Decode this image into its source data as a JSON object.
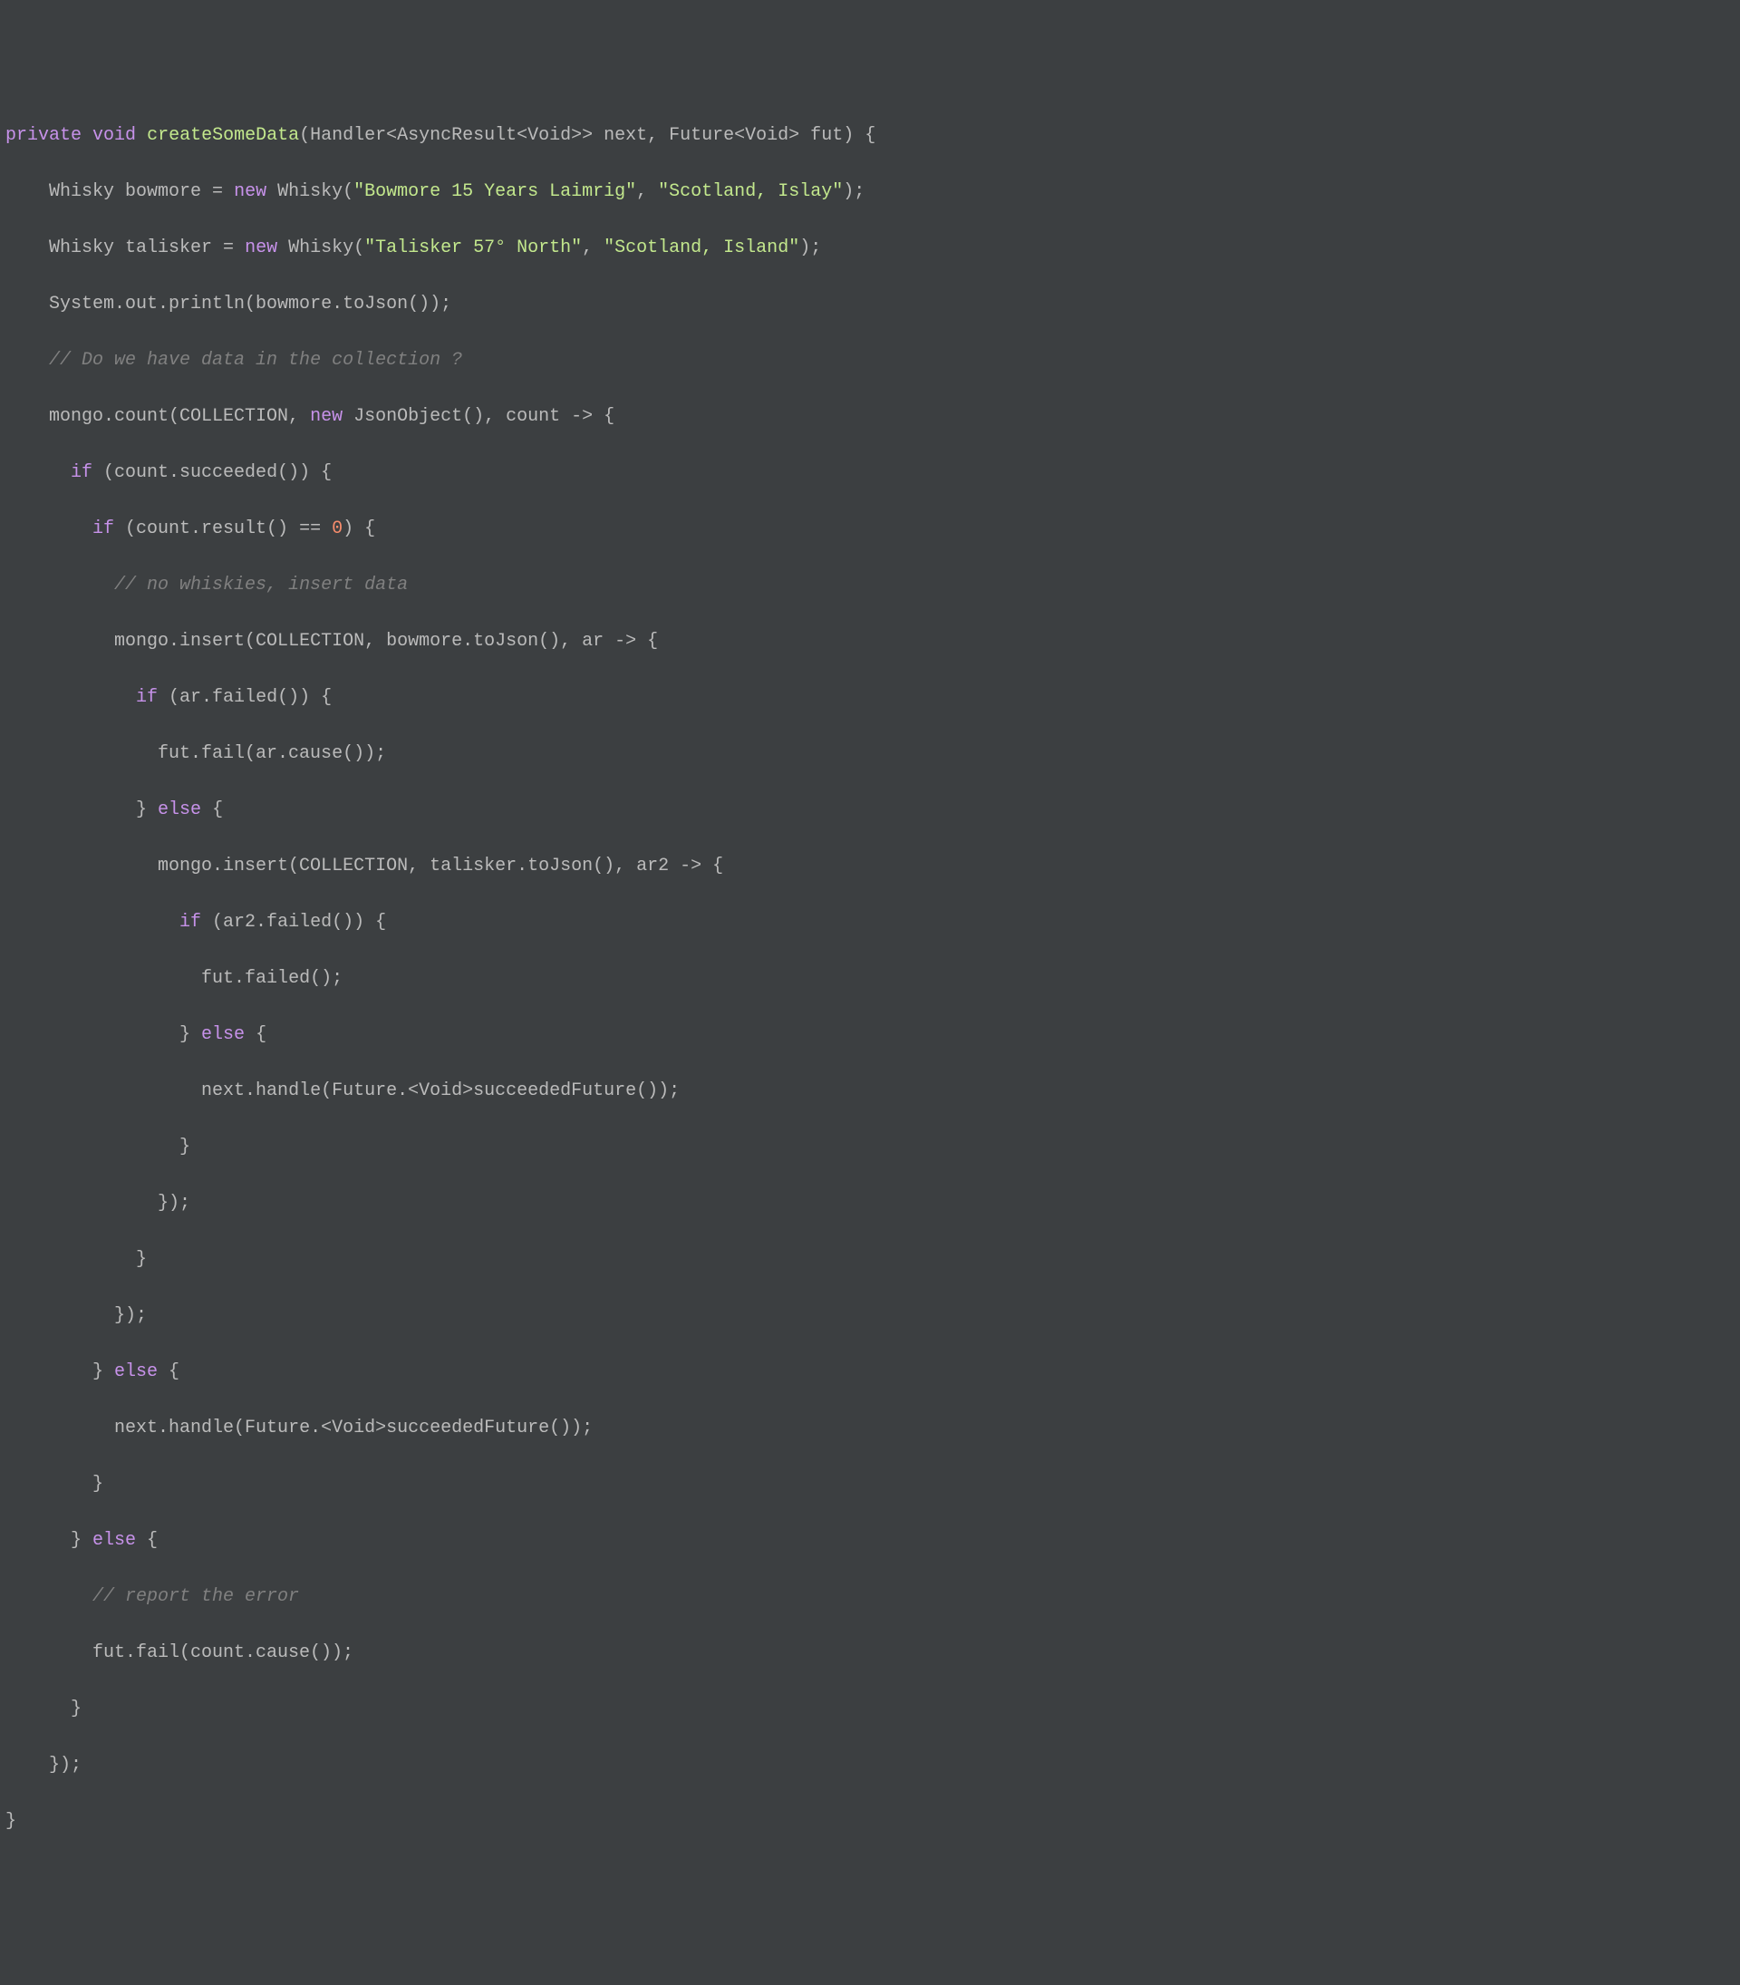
{
  "code": {
    "line1": {
      "private": "private",
      "void": "void",
      "methodName": "createSomeData",
      "params": "(Handler<AsyncResult<Void>> next, Future<Void> fut) {"
    },
    "line2": {
      "type": "Whisky ",
      "var": "bowmore = ",
      "new": "new",
      "ctor": " Whisky(",
      "str1": "\"Bowmore 15 Years Laimrig\"",
      "sep": ", ",
      "str2": "\"Scotland, Islay\"",
      "end": ");"
    },
    "line3": {
      "type": "Whisky ",
      "var": "talisker = ",
      "new": "new",
      "ctor": " Whisky(",
      "str1": "\"Talisker 57° North\"",
      "sep": ", ",
      "str2": "\"Scotland, Island\"",
      "end": ");"
    },
    "line4": "System.out.println(bowmore.toJson());",
    "line5": "// Do we have data in the collection ?",
    "line6": {
      "prefix": "mongo.count(COLLECTION, ",
      "new": "new",
      "ctor": " JsonObject(), count -> {"
    },
    "line7": {
      "if": "if",
      "cond": " (count.succeeded()) {"
    },
    "line8": {
      "if": "if",
      "cond1": " (count.result() == ",
      "zero": "0",
      "cond2": ") {"
    },
    "line9": "// no whiskies, insert data",
    "line10": "mongo.insert(COLLECTION, bowmore.toJson(), ar -> {",
    "line11": {
      "if": "if",
      "cond": " (ar.failed()) {"
    },
    "line12": "fut.fail(ar.cause());",
    "line13a": "} ",
    "line13b": "else",
    "line13c": " {",
    "line14": "mongo.insert(COLLECTION, talisker.toJson(), ar2 -> {",
    "line15": {
      "if": "if",
      "cond": " (ar2.failed()) {"
    },
    "line16": "fut.failed();",
    "line17a": "} ",
    "line17b": "else",
    "line17c": " {",
    "line18": "next.handle(Future.<Void>succeededFuture());",
    "line19": "}",
    "line20": "});",
    "line21": "}",
    "line22": "});",
    "line23a": "} ",
    "line23b": "else",
    "line23c": " {",
    "line24": "next.handle(Future.<Void>succeededFuture());",
    "line25": "}",
    "line26a": "} ",
    "line26b": "else",
    "line26c": " {",
    "line27": "// report the error",
    "line28": "fut.fail(count.cause());",
    "line29": "}",
    "line30": "});",
    "line31": "}"
  }
}
